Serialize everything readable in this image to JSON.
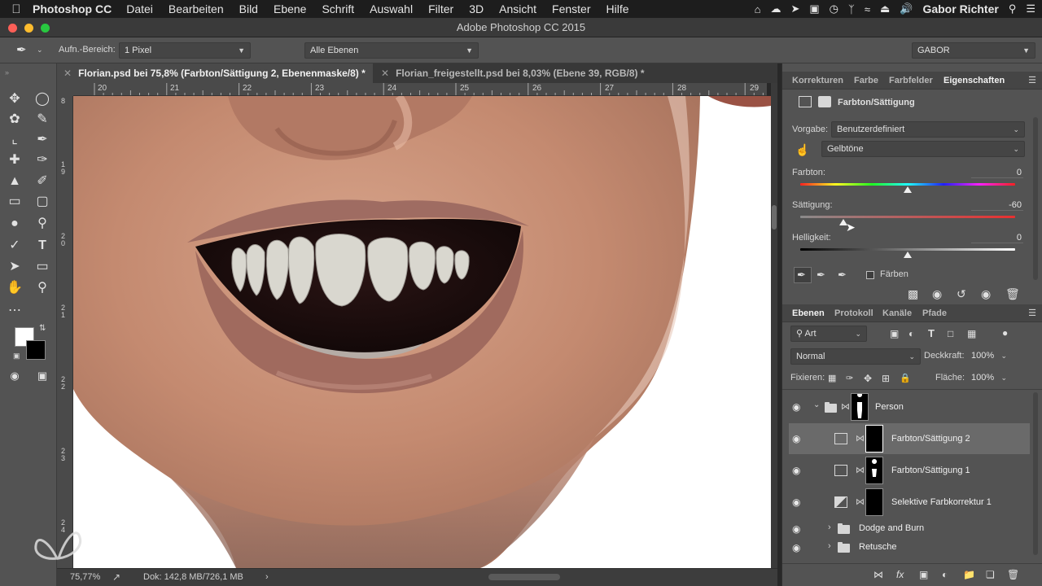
{
  "menubar": {
    "app": "Photoshop CC",
    "items": [
      "Datei",
      "Bearbeiten",
      "Bild",
      "Ebene",
      "Schrift",
      "Auswahl",
      "Filter",
      "3D",
      "Ansicht",
      "Fenster",
      "Hilfe"
    ],
    "user": "Gabor Richter"
  },
  "window": {
    "title": "Adobe Photoshop CC 2015"
  },
  "options": {
    "sample_label": "Aufn.-Bereich:",
    "sample_value": "1 Pixel",
    "layers_value": "Alle Ebenen",
    "workspace": "GABOR"
  },
  "tabs": [
    {
      "label": "Florian.psd bei 75,8% (Farbton/Sättigung 2, Ebenenmaske/8) *",
      "active": true
    },
    {
      "label": "Florian_freigestellt.psd bei 8,03% (Ebene 39, RGB/8) *",
      "active": false
    }
  ],
  "ruler": {
    "top": [
      "20",
      "21",
      "22",
      "23",
      "24",
      "25",
      "26",
      "27",
      "28",
      "29"
    ],
    "left": [
      {
        "text": "8"
      },
      {
        "text": "1\n9"
      },
      {
        "text": "2\n0"
      },
      {
        "text": "2\n1"
      },
      {
        "text": "2\n2"
      },
      {
        "text": "2\n3"
      },
      {
        "text": "2\n4"
      }
    ]
  },
  "status": {
    "zoom": "75,77%",
    "doc": "Dok: 142,8 MB/726,1 MB"
  },
  "panel_top": {
    "tabs": [
      "Korrekturen",
      "Farbe",
      "Farbfelder",
      "Eigenschaften"
    ],
    "active_tab": "Eigenschaften",
    "title": "Farbton/Sättigung",
    "preset_label": "Vorgabe:",
    "preset_value": "Benutzerdefiniert",
    "range_value": "Gelbtöne",
    "hue": {
      "label": "Farbton:",
      "value": "0",
      "level": 0
    },
    "saturation": {
      "label": "Sättigung:",
      "value": "-60",
      "level": -60
    },
    "lightness": {
      "label": "Helligkeit:",
      "value": "0",
      "level": 0
    },
    "colorize_label": "Färben"
  },
  "layers_panel": {
    "tabs": [
      "Ebenen",
      "Protokoll",
      "Kanäle",
      "Pfade"
    ],
    "active_tab": "Ebenen",
    "filter": "Art",
    "blend_mode": "Normal",
    "opacity_label": "Deckkraft:",
    "opacity_value": "100%",
    "lock_label": "Fixieren:",
    "fill_label": "Fläche:",
    "fill_value": "100%",
    "layers": [
      {
        "name": "Person",
        "kind": "group-open"
      },
      {
        "name": "Farbton/Sättigung 2",
        "kind": "adjustment",
        "selected": true
      },
      {
        "name": "Farbton/Sättigung 1",
        "kind": "adjustment"
      },
      {
        "name": "Selektive Farbkorrektur 1",
        "kind": "adjustment"
      },
      {
        "name": "Dodge and Burn",
        "kind": "group"
      },
      {
        "name": "Retusche",
        "kind": "group"
      }
    ]
  },
  "colors": {
    "accent_selected_layer": "#6a6a6a",
    "panel_bg": "#535353",
    "canvas_skin": "#c98f76"
  }
}
